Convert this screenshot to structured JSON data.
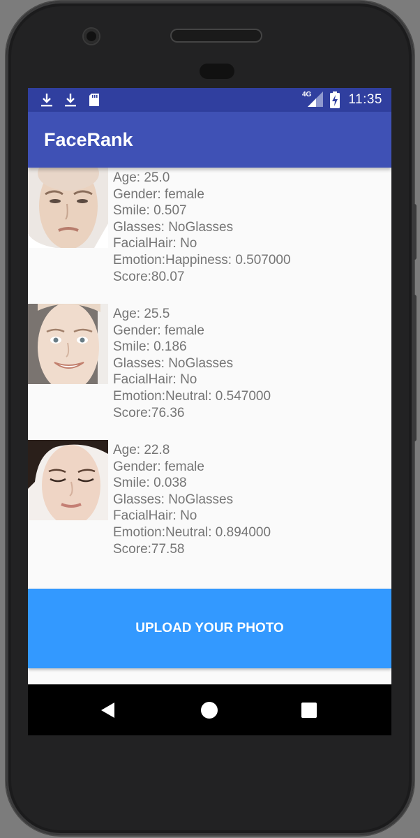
{
  "status_bar": {
    "time": "11:35",
    "network_label": "4G",
    "icons": [
      "download-icon",
      "download-icon",
      "sd-card-icon",
      "signal-icon",
      "battery-charging-icon"
    ]
  },
  "app_bar": {
    "title": "FaceRank"
  },
  "faces": [
    {
      "age": "Age: 25.0",
      "gender": "Gender: female",
      "smile": "Smile: 0.507",
      "glasses": "Glasses: NoGlasses",
      "facial_hair": "FacialHair: No",
      "emotion": "Emotion:Happiness: 0.507000",
      "score": "Score:80.07"
    },
    {
      "age": "Age: 25.5",
      "gender": "Gender: female",
      "smile": "Smile: 0.186",
      "glasses": "Glasses: NoGlasses",
      "facial_hair": "FacialHair: No",
      "emotion": "Emotion:Neutral: 0.547000",
      "score": "Score:76.36"
    },
    {
      "age": "Age: 22.8",
      "gender": "Gender: female",
      "smile": "Smile: 0.038",
      "glasses": "Glasses: NoGlasses",
      "facial_hair": "FacialHair: No",
      "emotion": "Emotion:Neutral: 0.894000",
      "score": "Score:77.58"
    }
  ],
  "upload_button": {
    "label": "UPLOAD YOUR PHOTO"
  },
  "nav_bar": {
    "icons": [
      "back-icon",
      "home-icon",
      "recents-icon"
    ]
  },
  "colors": {
    "status_bar": "#303f9f",
    "app_bar": "#3f51b5",
    "upload_button": "#3399ff",
    "text": "#757575"
  }
}
